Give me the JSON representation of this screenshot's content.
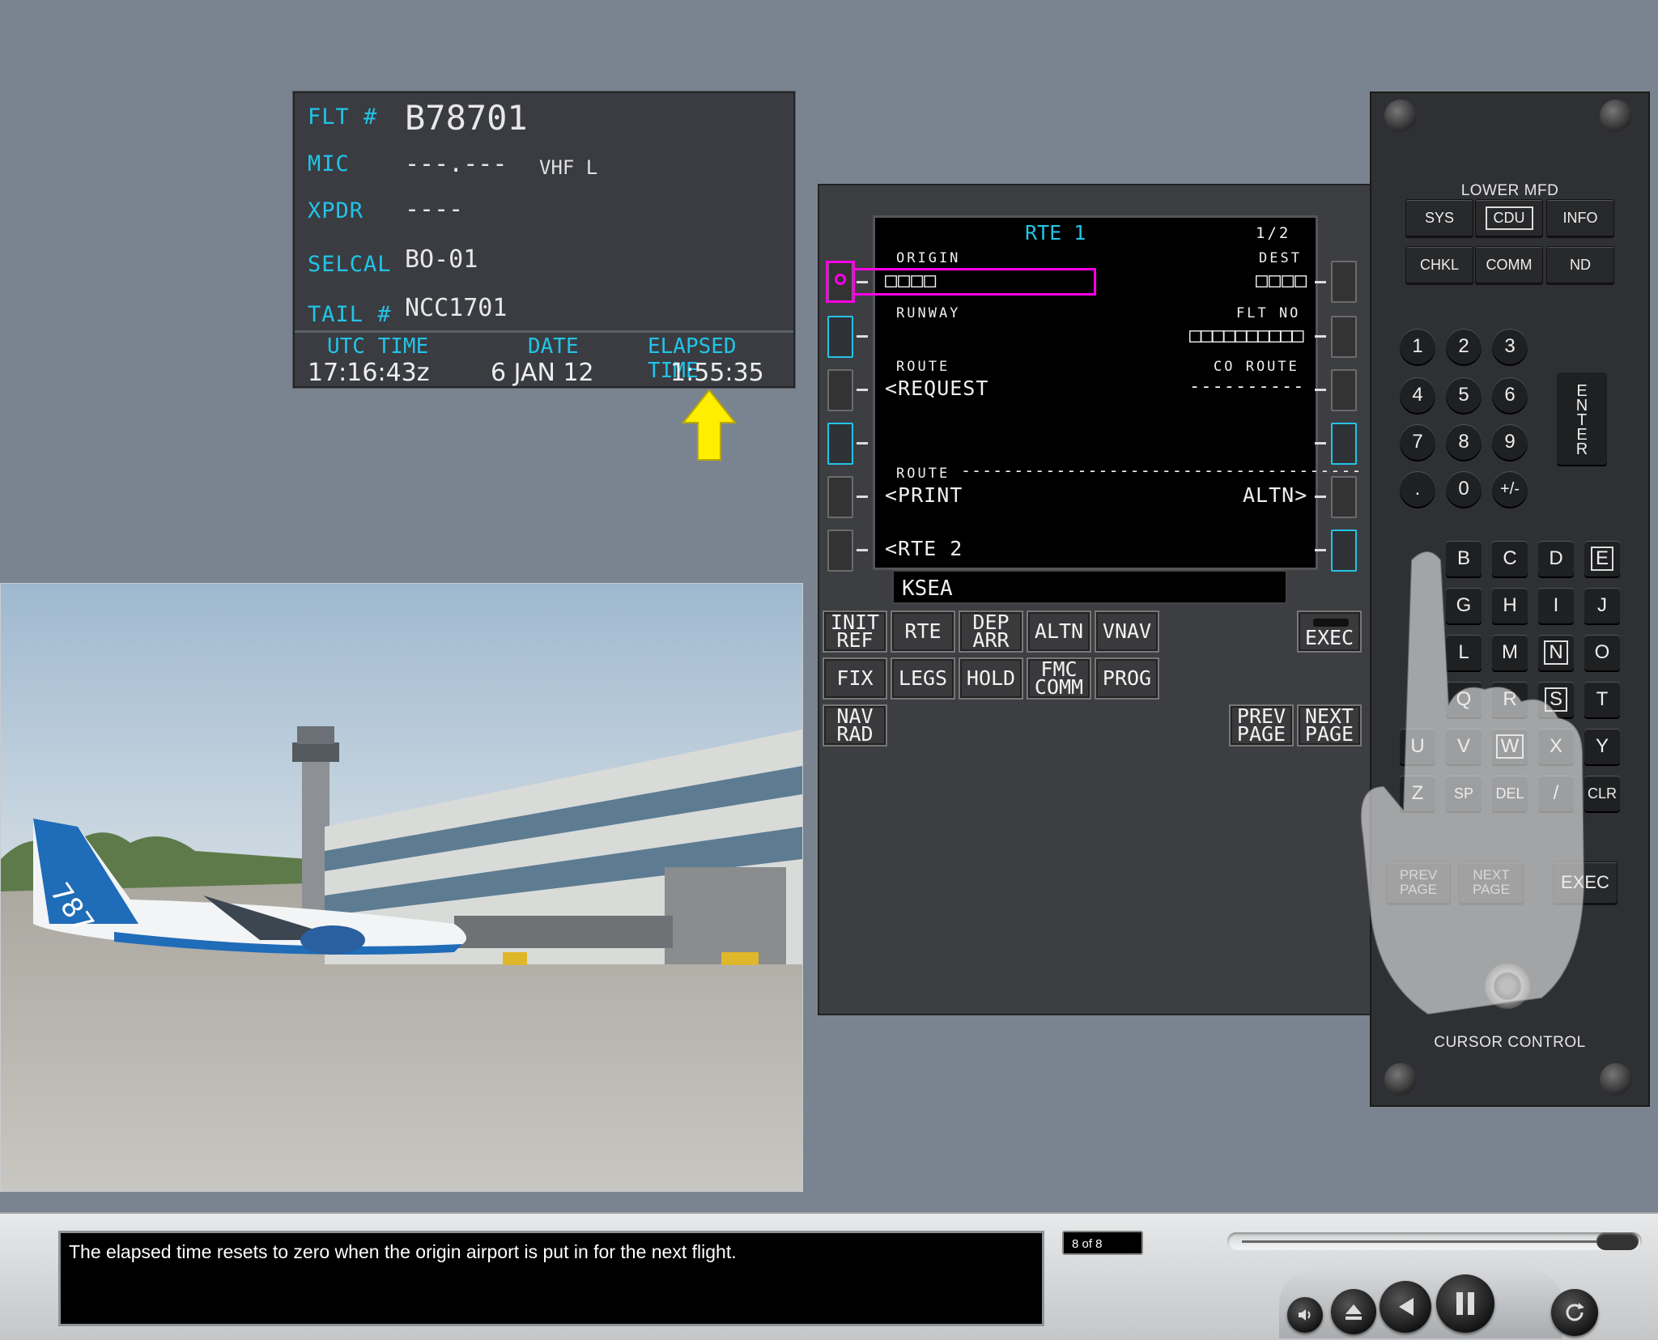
{
  "flight_info": {
    "flt_label": "FLT #",
    "flt_value": "B78701",
    "mic_label": "MIC",
    "mic_value": "---.---",
    "mic_radio": "VHF L",
    "xpdr_label": "XPDR",
    "xpdr_value": "----",
    "selcal_label": "SELCAL",
    "selcal_value": "BO-01",
    "tail_label": "TAIL #",
    "tail_value": "NCC1701",
    "utc_label": "UTC TIME",
    "utc_value": "17:16:43z",
    "date_label": "DATE",
    "date_value": "6 JAN 12",
    "elapsed_label": "ELAPSED TIME",
    "elapsed_value": "1:55:35"
  },
  "cdu": {
    "title": "RTE 1",
    "page": "1/2",
    "origin_label": "ORIGIN",
    "origin_value": "□□□□",
    "dest_label": "DEST",
    "dest_value": "□□□□",
    "runway_label": "RUNWAY",
    "flt_no_label": "FLT NO",
    "flt_no_value": "□□□□□□□□□□",
    "route_label": "ROUTE",
    "route_request": "<REQUEST",
    "co_route_label": "CO ROUTE",
    "co_route_value": "----------",
    "route2_label": "ROUTE",
    "route_print": "<PRINT",
    "altn": "ALTN>",
    "rte2": "<RTE 2",
    "scratchpad": "KSEA",
    "function_keys": {
      "init_ref": "INIT REF",
      "rte": "RTE",
      "dep_arr": "DEP ARR",
      "altn": "ALTN",
      "vnav": "VNAV",
      "fix": "FIX",
      "legs": "LEGS",
      "hold": "HOLD",
      "fmc_comm": "FMC COMM",
      "prog": "PROG",
      "nav_rad": "NAV RAD",
      "prev_page": "PREV PAGE",
      "next_page": "NEXT PAGE",
      "exec": "EXEC"
    }
  },
  "mfd_panel": {
    "title": "LOWER MFD",
    "keys_row1": [
      "SYS",
      "CDU",
      "INFO"
    ],
    "keys_row2": [
      "CHKL",
      "COMM",
      "ND"
    ],
    "digits": [
      "1",
      "2",
      "3",
      "4",
      "5",
      "6",
      "7",
      "8",
      "9",
      ".",
      "0",
      "+/-"
    ],
    "enter": "ENTER",
    "letters_row1": [
      "B",
      "C",
      "D",
      "E"
    ],
    "letters_row2": [
      "G",
      "H",
      "I",
      "J"
    ],
    "letters_row3": [
      "L",
      "M",
      "N",
      "O"
    ],
    "letters_row4": [
      "Q",
      "R",
      "S",
      "T"
    ],
    "letters_row5": [
      "U",
      "V",
      "W",
      "X",
      "Y"
    ],
    "letters_row6": [
      "Z",
      "SP",
      "DEL",
      "/",
      "CLR"
    ],
    "prev_page": "PREV PAGE",
    "next_page": "NEXT PAGE",
    "exec": "EXEC",
    "cursor_label": "CURSOR CONTROL"
  },
  "bottom": {
    "caption": "The elapsed time resets to zero when the origin airport is put in for the next flight.",
    "page_counter": "8 of 8",
    "progress": 0.97
  },
  "colors": {
    "background": "#7a8490",
    "cyan_label": "#22c4e6",
    "magenta_highlight": "#ff00e6",
    "arrow_yellow": "#ffee00"
  }
}
